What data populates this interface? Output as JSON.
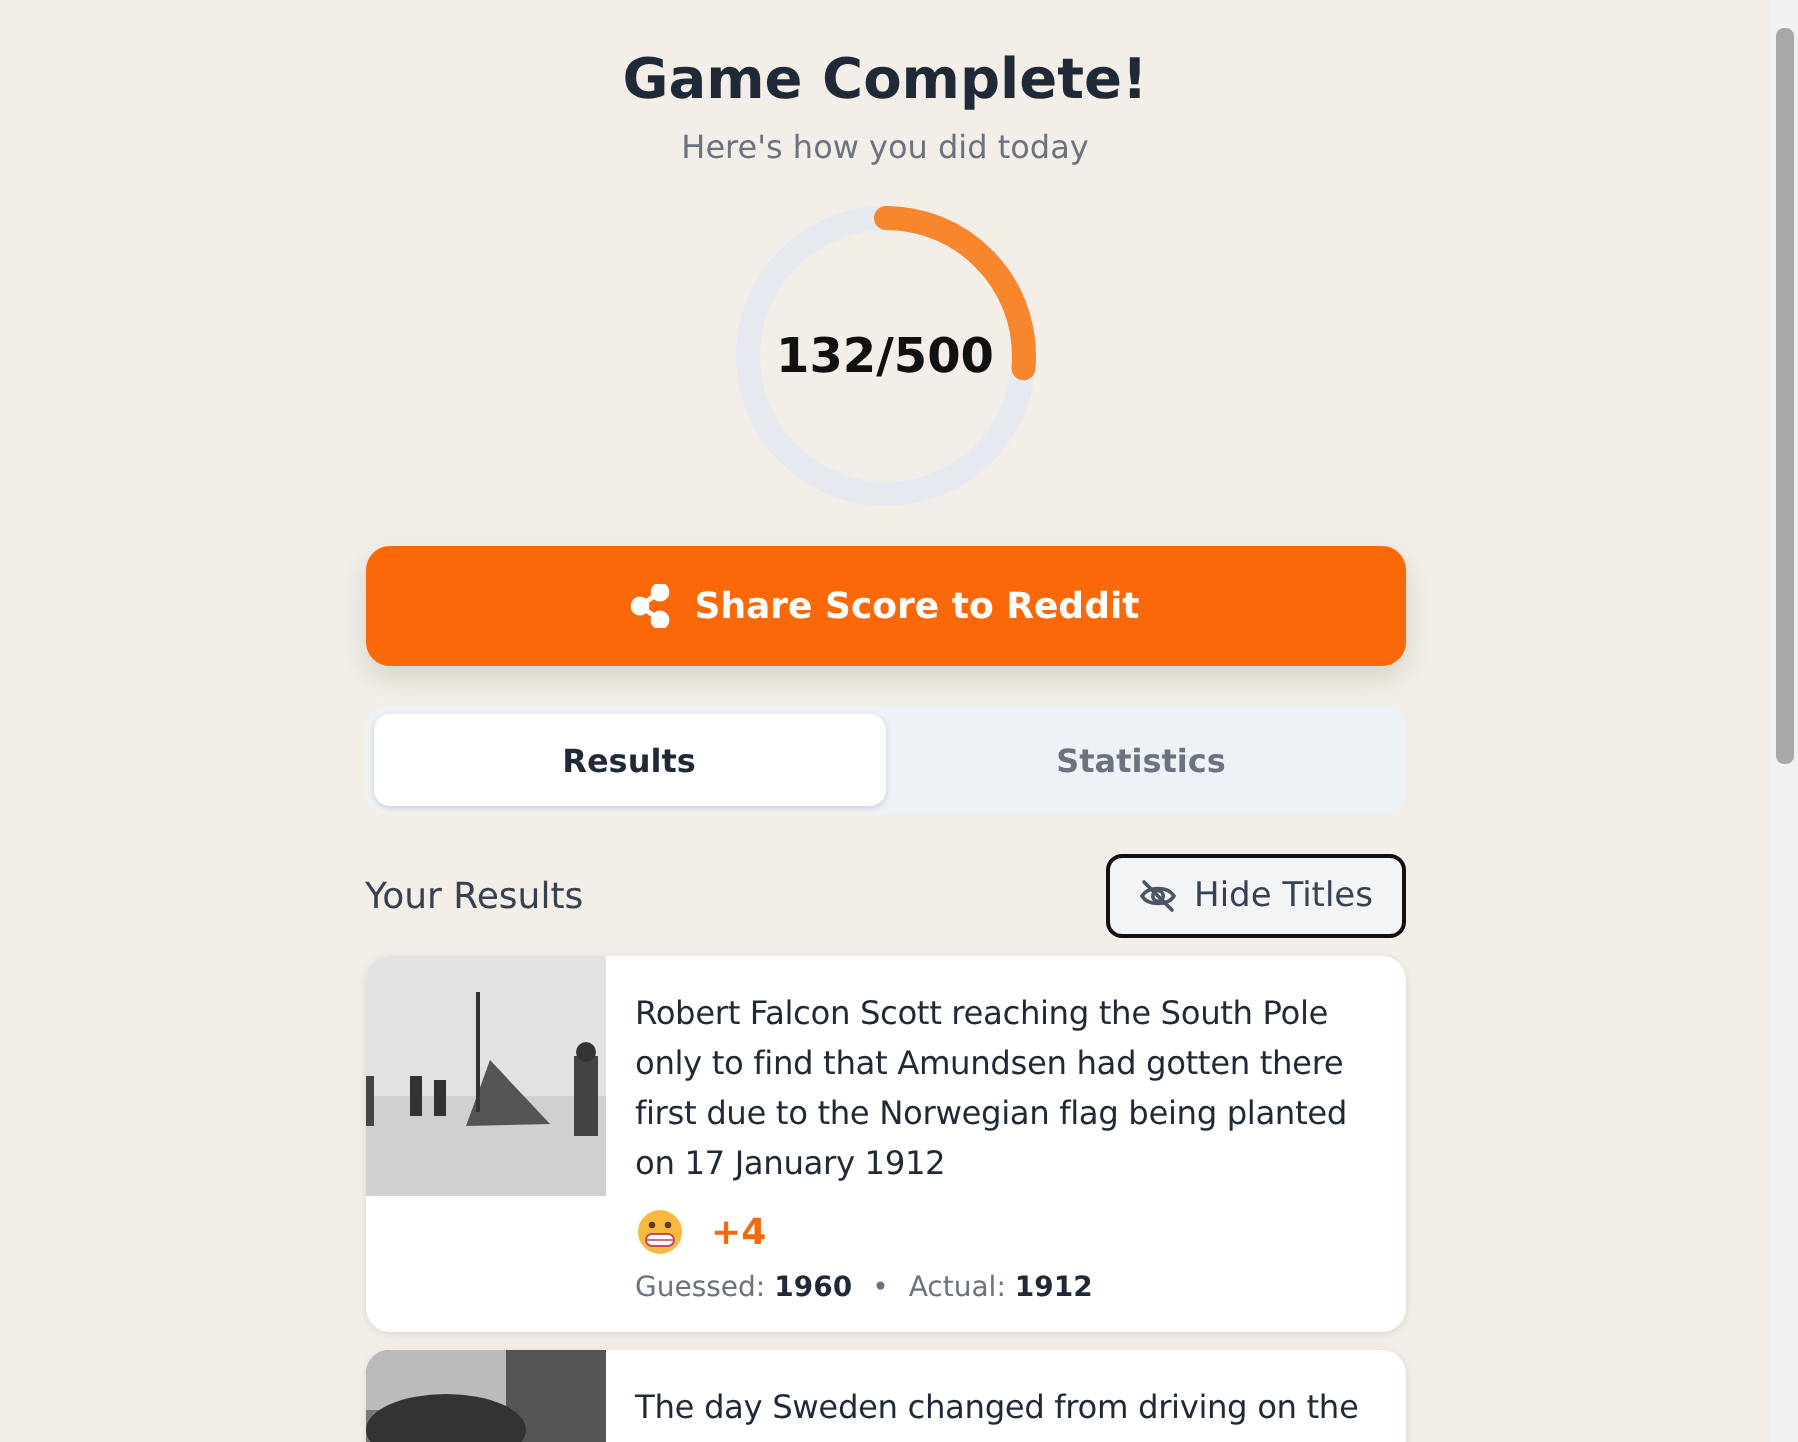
{
  "header": {
    "title": "Game Complete!",
    "subtitle": "Here's how you did today"
  },
  "score": {
    "text": "132/500"
  },
  "share_button": {
    "label": "Share Score to Reddit"
  },
  "tabs": [
    {
      "label": "Results",
      "selected": true
    },
    {
      "label": "Statistics",
      "selected": false
    }
  ],
  "results": {
    "heading": "Your Results",
    "toggle_button": {
      "label": "Hide Titles"
    },
    "items": [
      {
        "title": "Robert Falcon Scott reaching the South Pole only to find that Amundsen had gotten there first due to the Norwegian flag being planted on 17 January 1912",
        "points": "+4",
        "guessed_label": "Guessed:",
        "guessed": "1960",
        "separator": "•",
        "actual_label": "Actual:",
        "actual": "1912"
      },
      {
        "title": "The day Sweden changed from driving on the"
      }
    ]
  }
}
